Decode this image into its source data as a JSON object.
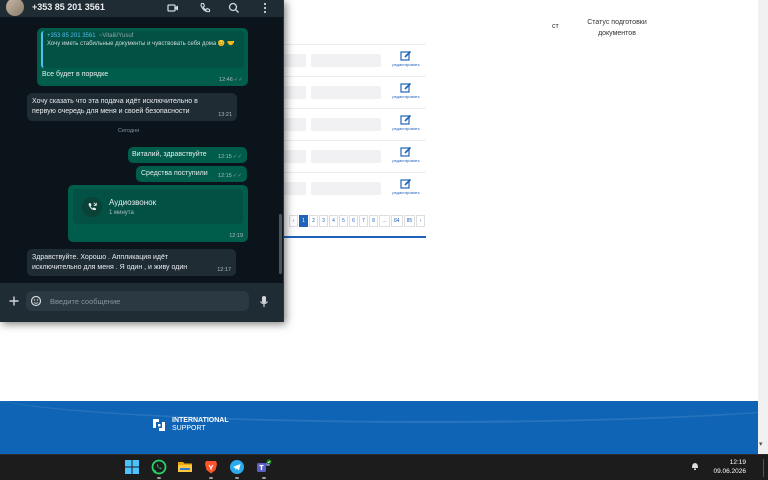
{
  "background_page": {
    "columns": [
      "ст",
      "Статус подготовки документов"
    ],
    "rows": [
      {
        "action_label": "редактировать"
      },
      {
        "action_label": "редактировать"
      },
      {
        "action_label": "редактировать"
      },
      {
        "action_label": "редактировать"
      },
      {
        "action_label": "редактировать"
      }
    ],
    "pagination": [
      "‹",
      "1",
      "2",
      "3",
      "4",
      "5",
      "6",
      "7",
      "8",
      "…",
      "84",
      "85",
      "›"
    ],
    "pagination_active": "1",
    "footer_logo": [
      "INTERNATIONAL",
      "SUPPORT"
    ],
    "brand_color": "#0f64b5"
  },
  "whatsapp": {
    "contact": "+353 85 201 3561",
    "header_icons": [
      "video-call-icon",
      "phone-icon",
      "search-icon",
      "more-icon"
    ],
    "date_separator": "Сегодня",
    "messages": [
      {
        "direction": "out",
        "quote_author": "+353 85 201 3561",
        "quote_alias": "~Vitalii/Yusuf",
        "quote_text": "Хочу иметь стабильные документы и чувствовать себя дома 😊 🤝",
        "text": "Все будет в порядке",
        "time": "12:46"
      },
      {
        "direction": "in",
        "text": "Хочу сказать что эта подача идёт исключительно в первую очередь для меня и своей безопасности",
        "time": "13:21"
      },
      {
        "direction": "out",
        "text": "Виталий, здравствуйте",
        "time": "12:15"
      },
      {
        "direction": "out",
        "text": "Средства поступили",
        "time": "12:15"
      },
      {
        "direction": "out",
        "type": "call",
        "title": "Аудиозвонок",
        "duration": "1 минута",
        "time": "12:19"
      },
      {
        "direction": "in",
        "text": "Здравствуйте. Хорошо . Аппликация идёт исключительно для меня . Я один , и живу один",
        "time": "12:17"
      }
    ],
    "input_placeholder": "Введите сообщение",
    "colors": {
      "outgoing": "#005c4b",
      "incoming": "#202c33",
      "background": "#0b141a",
      "header": "#202c33"
    }
  },
  "taskbar": {
    "apps": [
      "windows-start",
      "whatsapp",
      "file-explorer",
      "brave-browser",
      "telegram",
      "teams"
    ],
    "time": "12:19",
    "date": "09.06.2026"
  }
}
